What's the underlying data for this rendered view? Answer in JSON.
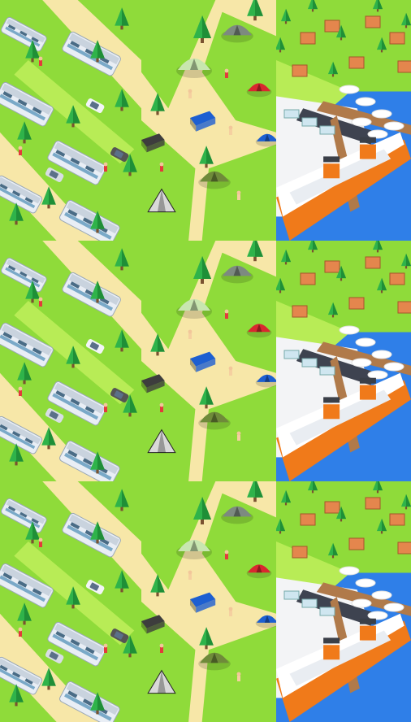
{
  "layout": {
    "columns": 3,
    "rows": 3
  },
  "scenes": [
    {
      "id": "rv-park",
      "label": ""
    },
    {
      "id": "campground",
      "label": ""
    },
    {
      "id": "harbor-resort",
      "label": ""
    }
  ],
  "colors": {
    "grass": "#8fdb3a",
    "grass_light": "#b8ec56",
    "sand": "#f7e7a8",
    "tree": "#2fb34a",
    "tree_dark": "#1f8f37",
    "rv_body": "#e9eef5",
    "rv_stripe": "#7aa9c8",
    "rv_roof": "#c9d3de",
    "tent_gray": "#7d8a80",
    "tent_red": "#d9282f",
    "tent_blue": "#1d5fd1",
    "tent_olive": "#6f8a3a",
    "tent_dark": "#3d3d3d",
    "road": "#3e4350",
    "water": "#2f7fe8",
    "ship_hull": "#ffffff",
    "ship_orange": "#f07a1a",
    "ship_funnel": "#3a3f48",
    "dock": "#b07a4a",
    "roof_orange": "#e4864d"
  }
}
